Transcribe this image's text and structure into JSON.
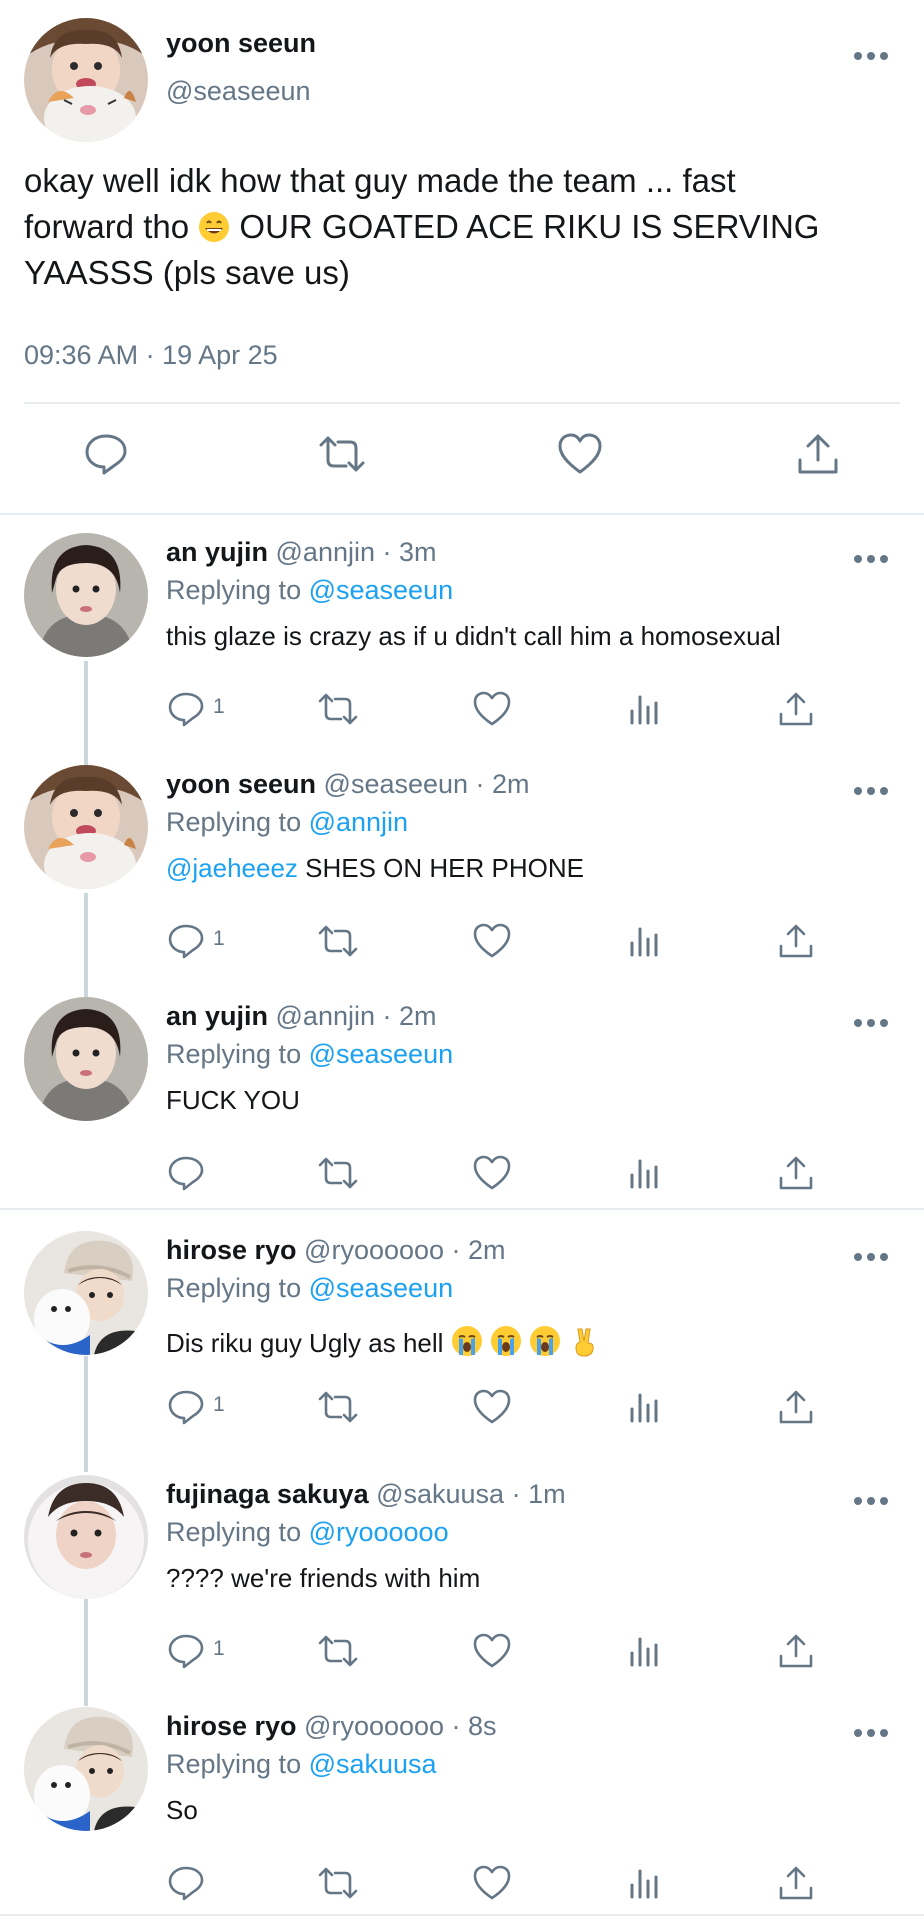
{
  "main_tweet": {
    "name": "yoon seeun",
    "handle": "@seaseeun",
    "text_line1": "okay well idk how that guy made the team ... fast",
    "text_line2_pre": "forward tho ",
    "text_line2_post": " OUR GOATED ACE RIKU IS SERVING",
    "text_line3": "YAASSS (pls save us)",
    "timestamp": "09:36 AM · 19 Apr 25"
  },
  "replies": [
    {
      "name": "an yujin",
      "meta": " @annjin · 3m",
      "replying_prefix": "Replying to ",
      "replying_to": "@seaseeun",
      "mention": "",
      "text": "this glaze is crazy as if u didn't call him a homosexual",
      "reply_count": "1"
    },
    {
      "name": "yoon seeun",
      "meta": " @seaseeun · 2m",
      "replying_prefix": "Replying to ",
      "replying_to": "@annjin",
      "mention": "@jaeheeez",
      "text": " SHES ON HER PHONE",
      "reply_count": "1"
    },
    {
      "name": "an yujin",
      "meta": " @annjin · 2m",
      "replying_prefix": "Replying to ",
      "replying_to": "@seaseeun",
      "mention": "",
      "text": "FUCK YOU",
      "reply_count": ""
    },
    {
      "name": "hirose ryo",
      "meta": " @ryoooooo · 2m",
      "replying_prefix": "Replying to ",
      "replying_to": "@seaseeun",
      "mention": "",
      "text": "Dis riku guy Ugly as hell ",
      "reply_count": "1"
    },
    {
      "name": "fujinaga sakuya",
      "meta": " @sakuusa · 1m",
      "replying_prefix": "Replying to ",
      "replying_to": "@ryoooooo",
      "mention": "",
      "text": "???? we're friends with him",
      "reply_count": "1"
    },
    {
      "name": "hirose ryo",
      "meta": " @ryoooooo · 8s",
      "replying_prefix": "Replying to ",
      "replying_to": "@sakuusa",
      "mention": "",
      "text": "So",
      "reply_count": ""
    }
  ],
  "colors": {
    "link": "#1da1f2",
    "secondary_text": "#657786",
    "divider": "#e6ecf0"
  }
}
